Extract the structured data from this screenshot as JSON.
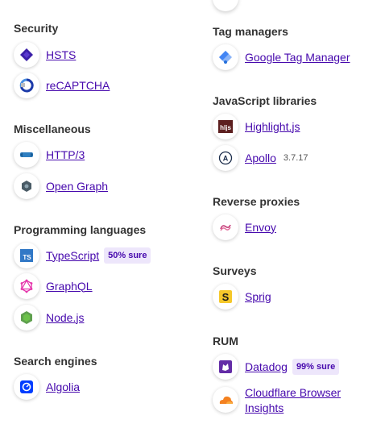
{
  "left_column": [
    {
      "title": "Security",
      "items": [
        {
          "name": "HSTS",
          "icon": "hsts-icon"
        },
        {
          "name": "reCAPTCHA",
          "icon": "recaptcha-icon"
        }
      ]
    },
    {
      "title": "Miscellaneous",
      "items": [
        {
          "name": "HTTP/3",
          "icon": "http3-icon"
        },
        {
          "name": "Open Graph",
          "icon": "open-graph-icon"
        }
      ]
    },
    {
      "title": "Programming languages",
      "items": [
        {
          "name": "TypeScript",
          "icon": "typescript-icon",
          "badge": "50% sure"
        },
        {
          "name": "GraphQL",
          "icon": "graphql-icon"
        },
        {
          "name": "Node.js",
          "icon": "nodejs-icon"
        }
      ]
    },
    {
      "title": "Search engines",
      "items": [
        {
          "name": "Algolia",
          "icon": "algolia-icon"
        }
      ]
    }
  ],
  "right_column": [
    {
      "title": "Tag managers",
      "items": [
        {
          "name": "Google Tag Manager",
          "icon": "google-tag-manager-icon"
        }
      ]
    },
    {
      "title": "JavaScript libraries",
      "items": [
        {
          "name": "Highlight.js",
          "icon": "highlightjs-icon"
        },
        {
          "name": "Apollo",
          "icon": "apollo-icon",
          "version": "3.7.17"
        }
      ]
    },
    {
      "title": "Reverse proxies",
      "items": [
        {
          "name": "Envoy",
          "icon": "envoy-icon"
        }
      ]
    },
    {
      "title": "Surveys",
      "items": [
        {
          "name": "Sprig",
          "icon": "sprig-icon"
        }
      ]
    },
    {
      "title": "RUM",
      "items": [
        {
          "name": "Datadog",
          "icon": "datadog-icon",
          "badge": "99% sure"
        },
        {
          "name": "Cloudflare Browser Insights",
          "icon": "cloudflare-icon"
        }
      ]
    }
  ],
  "colors": {
    "link": "#4608ad",
    "badge_bg": "#ede6fb",
    "text": "#333333"
  }
}
